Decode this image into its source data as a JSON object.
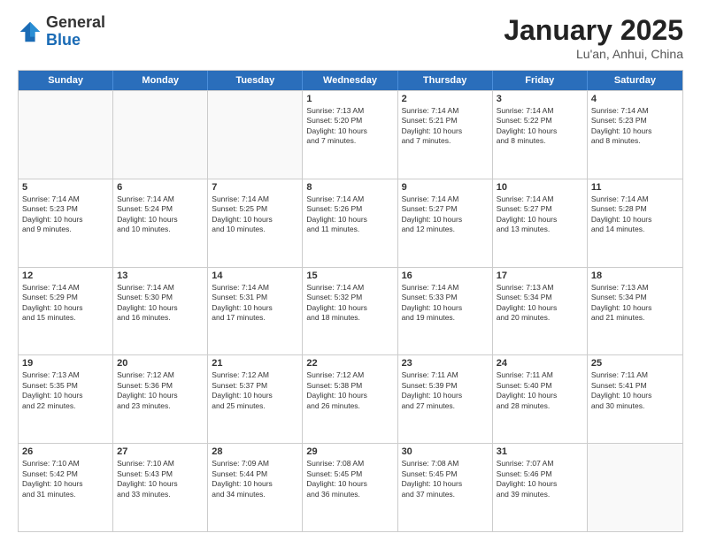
{
  "header": {
    "logo_general": "General",
    "logo_blue": "Blue",
    "title": "January 2025",
    "location": "Lu'an, Anhui, China"
  },
  "weekdays": [
    "Sunday",
    "Monday",
    "Tuesday",
    "Wednesday",
    "Thursday",
    "Friday",
    "Saturday"
  ],
  "rows": [
    {
      "cells": [
        {
          "day": "",
          "info": ""
        },
        {
          "day": "",
          "info": ""
        },
        {
          "day": "",
          "info": ""
        },
        {
          "day": "1",
          "info": "Sunrise: 7:13 AM\nSunset: 5:20 PM\nDaylight: 10 hours\nand 7 minutes."
        },
        {
          "day": "2",
          "info": "Sunrise: 7:14 AM\nSunset: 5:21 PM\nDaylight: 10 hours\nand 7 minutes."
        },
        {
          "day": "3",
          "info": "Sunrise: 7:14 AM\nSunset: 5:22 PM\nDaylight: 10 hours\nand 8 minutes."
        },
        {
          "day": "4",
          "info": "Sunrise: 7:14 AM\nSunset: 5:23 PM\nDaylight: 10 hours\nand 8 minutes."
        }
      ]
    },
    {
      "cells": [
        {
          "day": "5",
          "info": "Sunrise: 7:14 AM\nSunset: 5:23 PM\nDaylight: 10 hours\nand 9 minutes."
        },
        {
          "day": "6",
          "info": "Sunrise: 7:14 AM\nSunset: 5:24 PM\nDaylight: 10 hours\nand 10 minutes."
        },
        {
          "day": "7",
          "info": "Sunrise: 7:14 AM\nSunset: 5:25 PM\nDaylight: 10 hours\nand 10 minutes."
        },
        {
          "day": "8",
          "info": "Sunrise: 7:14 AM\nSunset: 5:26 PM\nDaylight: 10 hours\nand 11 minutes."
        },
        {
          "day": "9",
          "info": "Sunrise: 7:14 AM\nSunset: 5:27 PM\nDaylight: 10 hours\nand 12 minutes."
        },
        {
          "day": "10",
          "info": "Sunrise: 7:14 AM\nSunset: 5:27 PM\nDaylight: 10 hours\nand 13 minutes."
        },
        {
          "day": "11",
          "info": "Sunrise: 7:14 AM\nSunset: 5:28 PM\nDaylight: 10 hours\nand 14 minutes."
        }
      ]
    },
    {
      "cells": [
        {
          "day": "12",
          "info": "Sunrise: 7:14 AM\nSunset: 5:29 PM\nDaylight: 10 hours\nand 15 minutes."
        },
        {
          "day": "13",
          "info": "Sunrise: 7:14 AM\nSunset: 5:30 PM\nDaylight: 10 hours\nand 16 minutes."
        },
        {
          "day": "14",
          "info": "Sunrise: 7:14 AM\nSunset: 5:31 PM\nDaylight: 10 hours\nand 17 minutes."
        },
        {
          "day": "15",
          "info": "Sunrise: 7:14 AM\nSunset: 5:32 PM\nDaylight: 10 hours\nand 18 minutes."
        },
        {
          "day": "16",
          "info": "Sunrise: 7:14 AM\nSunset: 5:33 PM\nDaylight: 10 hours\nand 19 minutes."
        },
        {
          "day": "17",
          "info": "Sunrise: 7:13 AM\nSunset: 5:34 PM\nDaylight: 10 hours\nand 20 minutes."
        },
        {
          "day": "18",
          "info": "Sunrise: 7:13 AM\nSunset: 5:34 PM\nDaylight: 10 hours\nand 21 minutes."
        }
      ]
    },
    {
      "cells": [
        {
          "day": "19",
          "info": "Sunrise: 7:13 AM\nSunset: 5:35 PM\nDaylight: 10 hours\nand 22 minutes."
        },
        {
          "day": "20",
          "info": "Sunrise: 7:12 AM\nSunset: 5:36 PM\nDaylight: 10 hours\nand 23 minutes."
        },
        {
          "day": "21",
          "info": "Sunrise: 7:12 AM\nSunset: 5:37 PM\nDaylight: 10 hours\nand 25 minutes."
        },
        {
          "day": "22",
          "info": "Sunrise: 7:12 AM\nSunset: 5:38 PM\nDaylight: 10 hours\nand 26 minutes."
        },
        {
          "day": "23",
          "info": "Sunrise: 7:11 AM\nSunset: 5:39 PM\nDaylight: 10 hours\nand 27 minutes."
        },
        {
          "day": "24",
          "info": "Sunrise: 7:11 AM\nSunset: 5:40 PM\nDaylight: 10 hours\nand 28 minutes."
        },
        {
          "day": "25",
          "info": "Sunrise: 7:11 AM\nSunset: 5:41 PM\nDaylight: 10 hours\nand 30 minutes."
        }
      ]
    },
    {
      "cells": [
        {
          "day": "26",
          "info": "Sunrise: 7:10 AM\nSunset: 5:42 PM\nDaylight: 10 hours\nand 31 minutes."
        },
        {
          "day": "27",
          "info": "Sunrise: 7:10 AM\nSunset: 5:43 PM\nDaylight: 10 hours\nand 33 minutes."
        },
        {
          "day": "28",
          "info": "Sunrise: 7:09 AM\nSunset: 5:44 PM\nDaylight: 10 hours\nand 34 minutes."
        },
        {
          "day": "29",
          "info": "Sunrise: 7:08 AM\nSunset: 5:45 PM\nDaylight: 10 hours\nand 36 minutes."
        },
        {
          "day": "30",
          "info": "Sunrise: 7:08 AM\nSunset: 5:45 PM\nDaylight: 10 hours\nand 37 minutes."
        },
        {
          "day": "31",
          "info": "Sunrise: 7:07 AM\nSunset: 5:46 PM\nDaylight: 10 hours\nand 39 minutes."
        },
        {
          "day": "",
          "info": ""
        }
      ]
    }
  ]
}
